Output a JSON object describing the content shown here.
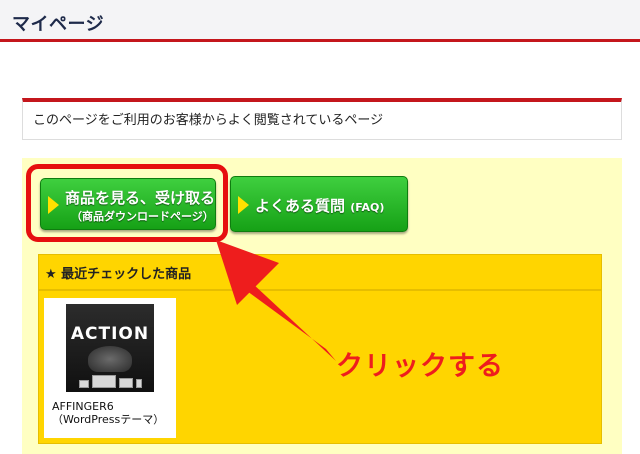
{
  "header": {
    "title": "マイページ"
  },
  "section": {
    "title": "このページをご利用のお客様からよく閲覧されているページ"
  },
  "buttons": {
    "download_line1": "商品を見る、受け取る",
    "download_line2": "（商品ダウンロードページ）",
    "faq_label": "よくある質問",
    "faq_sub": "(FAQ)"
  },
  "recent": {
    "title": "★ 最近チェックした商品",
    "products": [
      {
        "thumb_logo": "ACTION",
        "name": "AFFINGER6\n（WordPressテーマ）"
      }
    ]
  },
  "annotation": {
    "label": "クリックする"
  },
  "colors": {
    "header_rule": "#c4161c",
    "panel_bg": "#ffffc2",
    "recent_bg": "#ffd500",
    "button_green": "#22b322",
    "annotation_red": "#ee1d1d"
  },
  "icons": [
    "play-triangle-icon",
    "arrow-annotation-icon"
  ]
}
